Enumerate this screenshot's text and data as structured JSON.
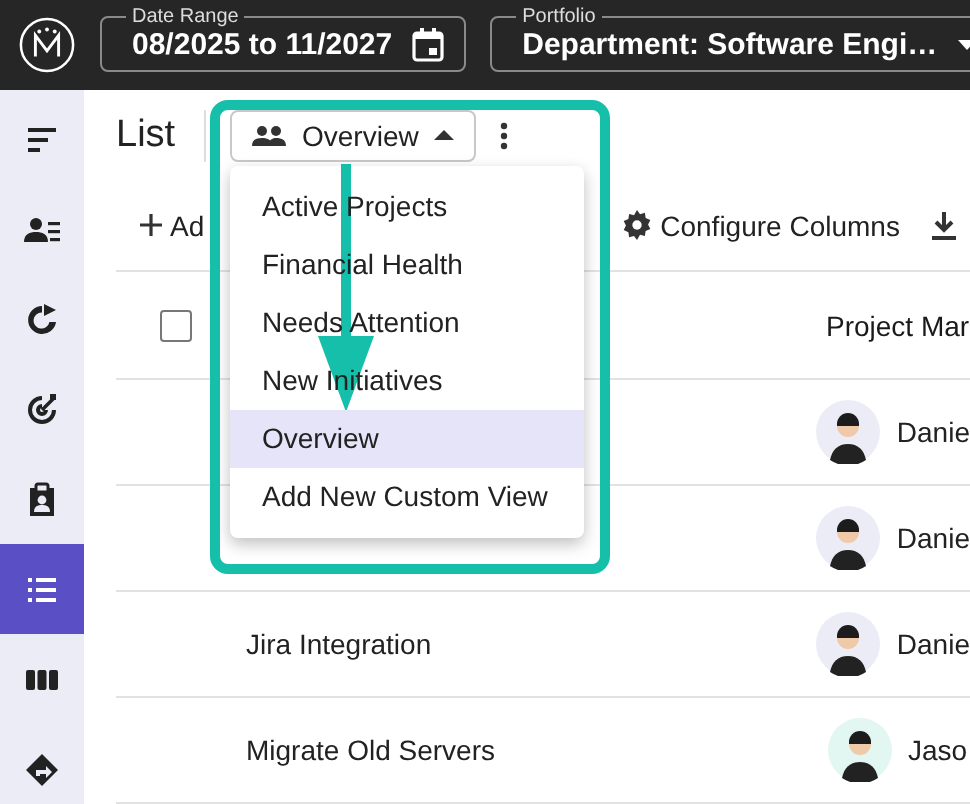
{
  "top_bar": {
    "date_range": {
      "label": "Date Range",
      "value": "08/2025 to 11/2027"
    },
    "portfolio": {
      "label": "Portfolio",
      "value": "Department: Software Engi…"
    }
  },
  "sidebar": {
    "items": [
      {
        "selected": false
      },
      {
        "selected": false
      },
      {
        "selected": false
      },
      {
        "selected": false
      },
      {
        "selected": false
      },
      {
        "selected": true
      },
      {
        "selected": false
      },
      {
        "selected": false
      }
    ]
  },
  "header": {
    "title": "List",
    "view_button": {
      "label": "Overview",
      "expanded": true
    }
  },
  "toolbar": {
    "add_button": "Ad",
    "configure_button": "Configure Columns"
  },
  "table": {
    "select_all": {
      "checked": false
    },
    "columns": [
      {
        "label": "Project Mar"
      }
    ],
    "rows": [
      {
        "manager": "Danie",
        "color": "#ececf7"
      },
      {
        "manager": "Danie",
        "color": "#ececf7"
      },
      {
        "name": "Jira Integration",
        "manager": "Danie",
        "color": "#ececf7"
      },
      {
        "name": "Migrate Old Servers",
        "manager": "Jaso",
        "color": "#e2f6f2"
      }
    ]
  },
  "view_menu": {
    "items": [
      {
        "label": "Active Projects",
        "selected": false
      },
      {
        "label": "Financial Health",
        "selected": false
      },
      {
        "label": "Needs Attention",
        "selected": false
      },
      {
        "label": "New Initiatives",
        "selected": false
      },
      {
        "label": "Overview",
        "selected": true
      },
      {
        "label": "Add New Custom View",
        "selected": false
      }
    ]
  }
}
